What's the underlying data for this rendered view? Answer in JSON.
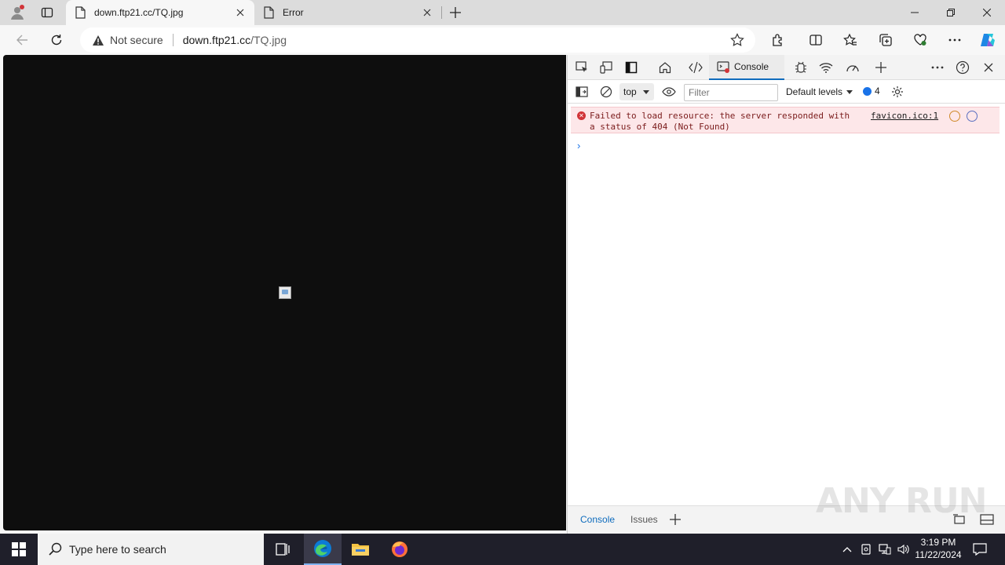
{
  "browser": {
    "tabs": [
      {
        "title": "down.ftp21.cc/TQ.jpg",
        "active": true
      },
      {
        "title": "Error",
        "active": false
      }
    ],
    "security_label": "Not secure",
    "url_host": "down.ftp21.cc",
    "url_path": "/TQ.jpg"
  },
  "devtools": {
    "console_tab_label": "Console",
    "context": "top",
    "filter_placeholder": "Filter",
    "levels_label": "Default levels",
    "issues_count": "4",
    "error_message_line1": "Failed to load resource: the server responded with",
    "error_message_line2": "a status of 404 (Not Found)",
    "error_source": "favicon.ico:1",
    "prompt": "›",
    "drawer_tabs": [
      "Console",
      "Issues"
    ]
  },
  "watermark": "ANY RUN",
  "taskbar": {
    "search_placeholder": "Type here to search",
    "time": "3:19 PM",
    "date": "11/22/2024"
  },
  "colors": {
    "accent": "#0f6cbd",
    "error_bg": "#fde7e9",
    "taskbar": "#1f1f2a",
    "viewport": "#0e0e0e"
  }
}
